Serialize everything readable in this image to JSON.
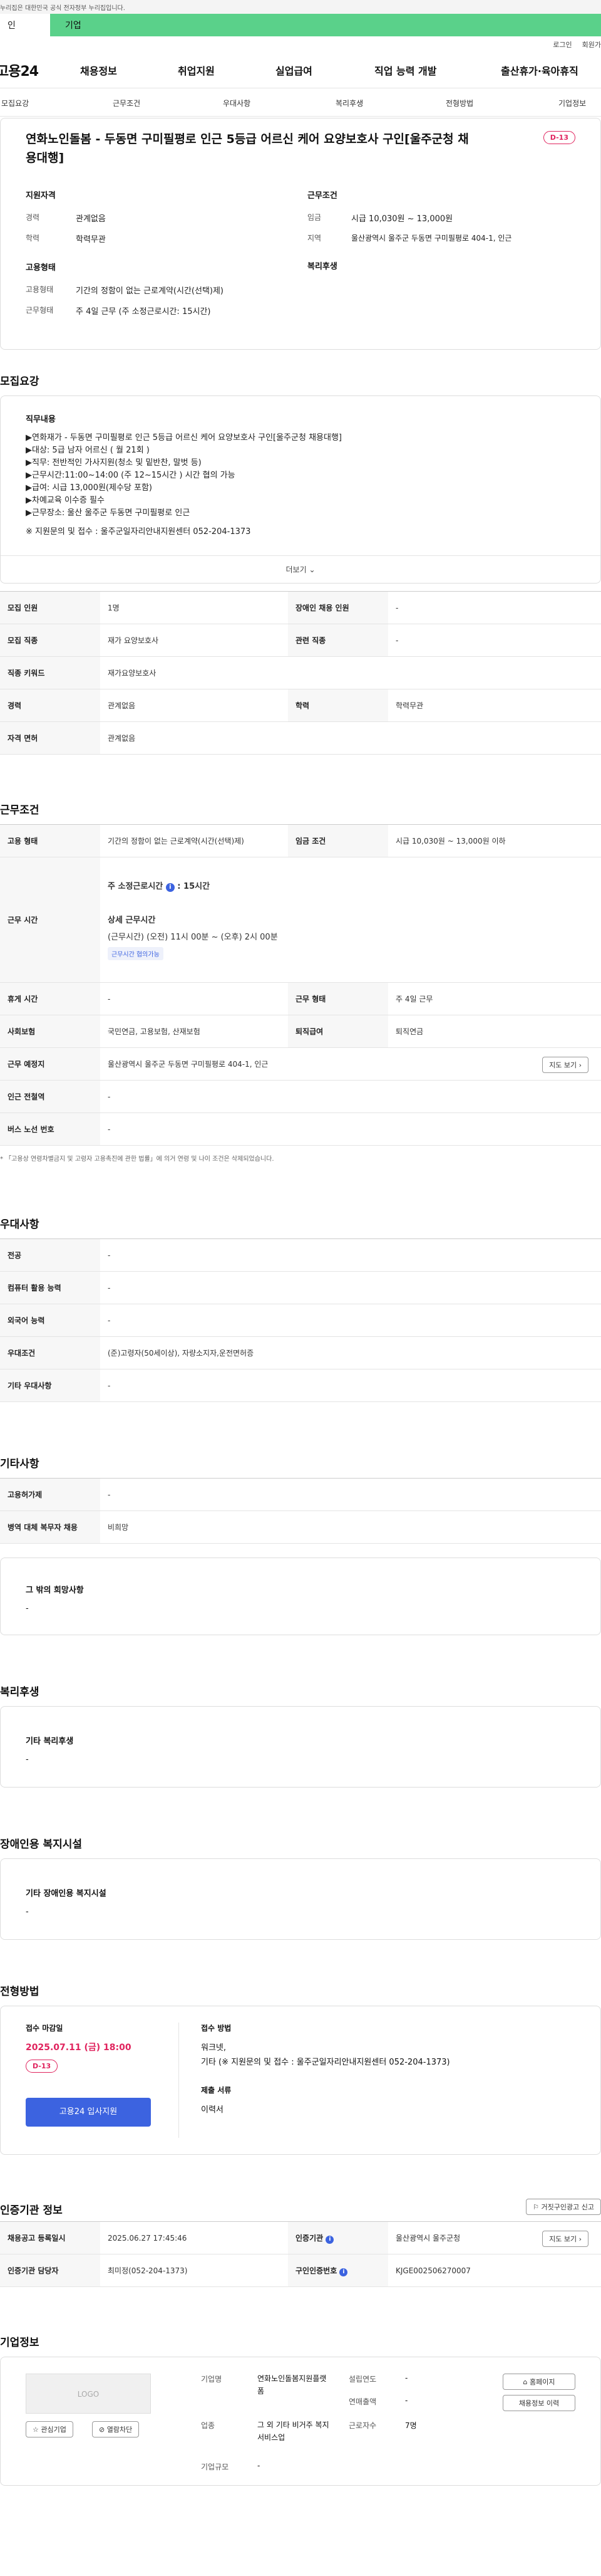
{
  "gov_notice": "누리집은 대한민국 공식 전자정부 누리집입니다.",
  "user_tabs": {
    "personal": "인",
    "corporate": "기업"
  },
  "util": {
    "login": "로그인",
    "join": "회원가"
  },
  "gnb": {
    "logo": "고용24",
    "menu": [
      "채용정보",
      "취업지원",
      "실업급여",
      "직업 능력 개발",
      "출산휴가·육아휴직"
    ]
  },
  "subnav": [
    "모집요강",
    "근무조건",
    "우대사항",
    "복리후생",
    "전형방법",
    "기업정보"
  ],
  "job": {
    "title": "연화노인돌봄 - 두동면 구미필평로 인근 5등급 어르신 케어 요양보호사 구인[울주군청 채용대행]",
    "dday": "D-13",
    "summary": {
      "qual_title": "지원자격",
      "cond_title": "근무조건",
      "emp_title": "고용형태",
      "welfare_title": "복리후생",
      "career_label": "경력",
      "career": "관계없음",
      "edu_label": "학력",
      "edu": "학력무관",
      "wage_label": "임금",
      "wage": "시급 10,030원 ~ 13,000원",
      "area_label": "지역",
      "area": "울산광역시 울주군 두동면 구미필평로 404-1, 인근",
      "emptype_label": "고용형태",
      "emptype": "기간의 정함이 없는 근로계약(시간(선택)제)",
      "worktype_label": "근무형태",
      "worktype": "주 4일 근무 (주 소정근로시간: 15시간)"
    }
  },
  "recruit": {
    "title": "모집요강",
    "duty_title": "직무내용",
    "duty_lines": [
      "▶연화재가 - 두동면 구미필평로 인근 5등급 어르신 케어 요양보호사 구인[울주군청 채용대행]",
      "▶대상: 5급 남자 어르신 ( 월 21회 )",
      "▶직무: 전반적인 가사지원(청소 및 밑반찬, 말벗 등)",
      "▶근무시간:11:00~14:00 (주 12~15시간 ) 시간 협의 가능",
      "▶급여: 시급 13,000원(제수당 포함)",
      "▶차예교육 이수증 필수",
      "▶근무장소: 울산 울주군 두동면 구미필평로 인근",
      "※ 지원문의 및 접수 : 울주군일자리안내지원센터 052-204-1373"
    ],
    "more": "더보기",
    "rows": [
      [
        "모집 인원",
        "1명",
        "장애인 채용 인원",
        "-"
      ],
      [
        "모집 직종",
        "재가 요양보호사",
        "관련 직종",
        "-"
      ],
      [
        "직종 키워드",
        "재가요양보호사"
      ],
      [
        "경력",
        "관계없음",
        "학력",
        "학력무관"
      ],
      [
        "자격 면허",
        "관계없음"
      ]
    ]
  },
  "conditions": {
    "title": "근무조건",
    "emptype_h": "고용 형태",
    "emptype": "기간의 정함이 없는 근로계약(시간(선택)제)",
    "wage_h": "임금 조건",
    "wage": "시급 10,030원 ~ 13,000원 이하",
    "hours_h": "근무 시간",
    "week_hours_label": "주 소정근로시간",
    "week_hours": "15시간",
    "detail_label": "상세 근무시간",
    "detail": "(근무시간) (오전) 11시 00분 ~ (오후) 2시 00분",
    "nego": "근무시간 협의가능",
    "rest_h": "휴게 시간",
    "rest": "-",
    "form_h": "근무 형태",
    "form": "주 4일 근무",
    "ins_h": "사회보험",
    "ins": "국민연금, 고용보험, 산재보험",
    "sev_h": "퇴직급여",
    "sev": "퇴직연금",
    "place_h": "근무 예정지",
    "place": "울산광역시 울주군 두동면 구미필평로 404-1, 인근",
    "map": "지도 보기",
    "subway_h": "인근 전철역",
    "subway": "-",
    "bus_h": "버스 노선 번호",
    "bus": "-",
    "note": "「고용상 연령차별금지 및 고령자 고용촉진에 관한 법률」에 의거 연령 및 나이 조건은 삭제되었습니다."
  },
  "pref": {
    "title": "우대사항",
    "rows": [
      [
        "전공",
        "-"
      ],
      [
        "컴퓨터 활용 능력",
        "-"
      ],
      [
        "외국어 능력",
        "-"
      ],
      [
        "우대조건",
        "(준)고령자(50세이상), 자량소지자,운전면허증"
      ],
      [
        "기타 우대사항",
        "-"
      ]
    ]
  },
  "etc": {
    "title": "기타사항",
    "rows": [
      [
        "고용허가제",
        "-"
      ],
      [
        "병역 대체 복무자 채용",
        "비희망"
      ]
    ],
    "other_title": "그 밖의 희망사항",
    "other": "-"
  },
  "welfare": {
    "title": "복리후생",
    "sub": "기타 복리후생",
    "val": "-"
  },
  "disabled": {
    "title": "장애인용 복지시설",
    "sub": "기타 장애인용 복지시설",
    "val": "-"
  },
  "process": {
    "title": "전형방법",
    "deadline_label": "접수 마감일",
    "deadline": "2025.07.11 (금) 18:00",
    "dday": "D-13",
    "apply": "고용24 입사지원",
    "method_label": "접수 방법",
    "method1": "워크넷,",
    "method2": "기타 (※ 지원문의 및 접수 : 울주군일자리안내지원센터 052-204-1373)",
    "docs_label": "제출 서류",
    "docs": "이력서"
  },
  "cert": {
    "title": "인증기관 정보",
    "report": "거짓구인광고 신고",
    "rows": [
      [
        "채용공고 등록일시",
        "2025.06.27 17:45:46",
        "인증기관",
        "울산광역시 울주군청"
      ],
      [
        "인증기관 담당자",
        "최미정(052-204-1373)",
        "구인인증번호",
        "KJGE002506270007"
      ]
    ],
    "map": "지도 보기"
  },
  "company": {
    "title": "기업정보",
    "logo": "LOGO",
    "fav": "관심기업",
    "block": "열람차단",
    "name_label": "기업명",
    "name": "연화노인돌봄지원플랫폼",
    "founded_label": "설립연도",
    "founded": "-",
    "industry_label": "업종",
    "industry": "그 외 기타 비거주 복지 서비스업",
    "revenue_label": "연매출액",
    "revenue": "-",
    "emp_label": "근로자수",
    "emp": "7명",
    "size_label": "기업규모",
    "size": "-",
    "home": "홈페이지",
    "other_jobs": "채용정보 이력"
  }
}
